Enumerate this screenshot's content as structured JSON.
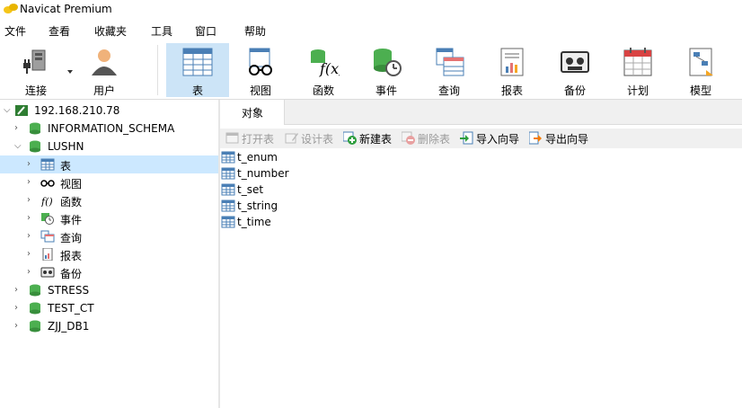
{
  "window": {
    "title": "Navicat Premium"
  },
  "menu": [
    "文件",
    "查看",
    "收藏夹",
    "工具",
    "窗口",
    "帮助"
  ],
  "toolbar": [
    {
      "label": "连接",
      "icon": "connection-plug-icon"
    },
    {
      "label": "用户",
      "icon": "user-icon"
    },
    {
      "label": "表",
      "icon": "table-icon",
      "active": true
    },
    {
      "label": "视图",
      "icon": "view-glasses-icon"
    },
    {
      "label": "函数",
      "icon": "function-icon"
    },
    {
      "label": "事件",
      "icon": "event-clock-icon"
    },
    {
      "label": "查询",
      "icon": "query-icon"
    },
    {
      "label": "报表",
      "icon": "report-icon"
    },
    {
      "label": "备份",
      "icon": "backup-icon"
    },
    {
      "label": "计划",
      "icon": "schedule-calendar-icon"
    },
    {
      "label": "模型",
      "icon": "model-icon"
    }
  ],
  "tree": [
    {
      "label": "192.168.210.78",
      "level": 0,
      "expanded": true,
      "icon": "server-icon"
    },
    {
      "label": "INFORMATION_SCHEMA",
      "level": 1,
      "expanded": false,
      "icon": "database-icon"
    },
    {
      "label": "LUSHN",
      "level": 1,
      "expanded": true,
      "icon": "database-icon"
    },
    {
      "label": "表",
      "level": 2,
      "selected": true,
      "icon": "table-icon"
    },
    {
      "label": "视图",
      "level": 2,
      "icon": "view-glasses-icon"
    },
    {
      "label": "函数",
      "level": 2,
      "icon": "function-icon"
    },
    {
      "label": "事件",
      "level": 2,
      "icon": "event-clock-icon"
    },
    {
      "label": "查询",
      "level": 2,
      "icon": "query-icon"
    },
    {
      "label": "报表",
      "level": 2,
      "icon": "report-icon"
    },
    {
      "label": "备份",
      "level": 2,
      "icon": "backup-icon"
    },
    {
      "label": "STRESS",
      "level": 1,
      "expanded": false,
      "icon": "database-icon"
    },
    {
      "label": "TEST_CT",
      "level": 1,
      "expanded": false,
      "icon": "database-icon"
    },
    {
      "label": "ZJJ_DB1",
      "level": 1,
      "expanded": false,
      "icon": "database-icon"
    }
  ],
  "tabs": {
    "objects": "对象"
  },
  "object_toolbar": [
    {
      "label": "打开表",
      "icon": "open-table-icon",
      "disabled": true
    },
    {
      "label": "设计表",
      "icon": "design-table-icon",
      "disabled": true
    },
    {
      "label": "新建表",
      "icon": "new-table-icon",
      "disabled": false
    },
    {
      "label": "删除表",
      "icon": "delete-table-icon",
      "disabled": true
    },
    {
      "label": "导入向导",
      "icon": "import-wizard-icon",
      "disabled": false
    },
    {
      "label": "导出向导",
      "icon": "export-wizard-icon",
      "disabled": false
    }
  ],
  "objects": [
    "t_enum",
    "t_number",
    "t_set",
    "t_string",
    "t_time"
  ],
  "colors": {
    "accent": "#cce4f7",
    "selected_row": "#cce8ff",
    "db_green": "#4caf50"
  }
}
